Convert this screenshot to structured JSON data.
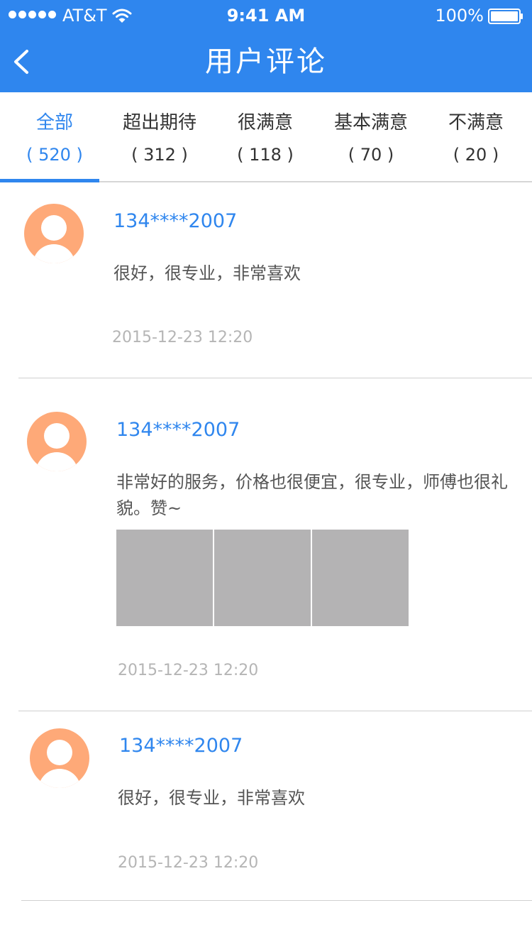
{
  "status_bar": {
    "carrier": "AT&T",
    "time": "9:41 AM",
    "battery": "100%",
    "signal_icon": "signal-dots-icon",
    "wifi_icon": "wifi-icon",
    "battery_icon": "battery-icon"
  },
  "nav": {
    "title": "用户评论",
    "back_icon": "chevron-left-icon"
  },
  "tabs": [
    {
      "label": "全部",
      "count": "( 520 )",
      "active": true
    },
    {
      "label": "超出期待",
      "count": "( 312 )",
      "active": false
    },
    {
      "label": "很满意",
      "count": "( 118 )",
      "active": false
    },
    {
      "label": "基本满意",
      "count": "( 70 )",
      "active": false
    },
    {
      "label": "不满意",
      "count": "( 20 )",
      "active": false
    }
  ],
  "reviews": [
    {
      "user": "134****2007",
      "text": "很好，很专业，非常喜欢",
      "time": "2015-12-23 12:20",
      "photos": 0
    },
    {
      "user": "134****2007",
      "text": "非常好的服务，价格也很便宜，很专业，师傅也很礼貌。赞~",
      "time": "2015-12-23 12:20",
      "photos": 3
    },
    {
      "user": "134****2007",
      "text": "很好，很专业，非常喜欢",
      "time": "2015-12-23 12:20",
      "photos": 0
    }
  ],
  "colors": {
    "brand": "#2f86ee",
    "avatar": "#fea978",
    "photo_placeholder": "#b4b3b4",
    "timestamp": "#b5b5b5"
  }
}
